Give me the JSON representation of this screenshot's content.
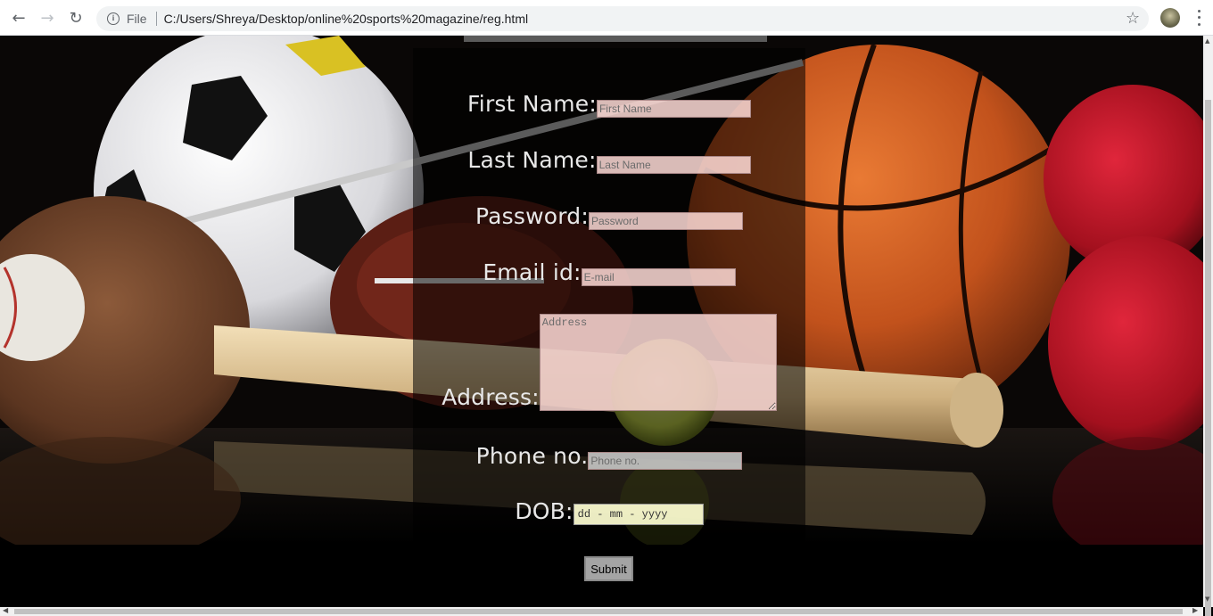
{
  "browser": {
    "scheme": "File",
    "url": "C:/Users/Shreya/Desktop/online%20sports%20magazine/reg.html"
  },
  "form": {
    "first_name": {
      "label": "First Name:",
      "placeholder": "First Name"
    },
    "last_name": {
      "label": "Last Name:",
      "placeholder": "Last Name"
    },
    "password": {
      "label": "Password:",
      "placeholder": "Password"
    },
    "email": {
      "label": "Email id:",
      "placeholder": "E-mail"
    },
    "address": {
      "label": "Address:",
      "placeholder": "Address"
    },
    "phone": {
      "label": "Phone no.",
      "placeholder": "Phone no."
    },
    "dob": {
      "label": "DOB:",
      "placeholder": "dd - mm - yyyy"
    },
    "submit_label": "Submit"
  }
}
